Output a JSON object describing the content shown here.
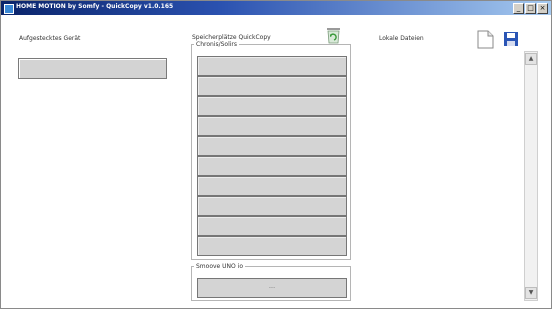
{
  "window": {
    "title": "HOME MOTION by Somfy - QuickCopy v1.0.165",
    "buttons": {
      "minimize": "_",
      "maximize": "□",
      "close": "×"
    }
  },
  "columns": {
    "device_label": "Aufgestecktes Gerät",
    "slots_label": "Speicherplätze QuickCopy",
    "local_label": "Lokale Dateien"
  },
  "groups": {
    "chronis_title": "Chronis/Solirs",
    "uno_title": "Smoove UNO io",
    "uno_slot_value": "---"
  },
  "scrollbar": {
    "up": "▲",
    "down": "▼"
  },
  "colors": {
    "titlebar_start": "#0a246a",
    "titlebar_end": "#a6caf0",
    "slot_fill": "#d4d4d4",
    "save_icon": "#2a55b5",
    "recycle_icon": "#3a9a3a"
  }
}
